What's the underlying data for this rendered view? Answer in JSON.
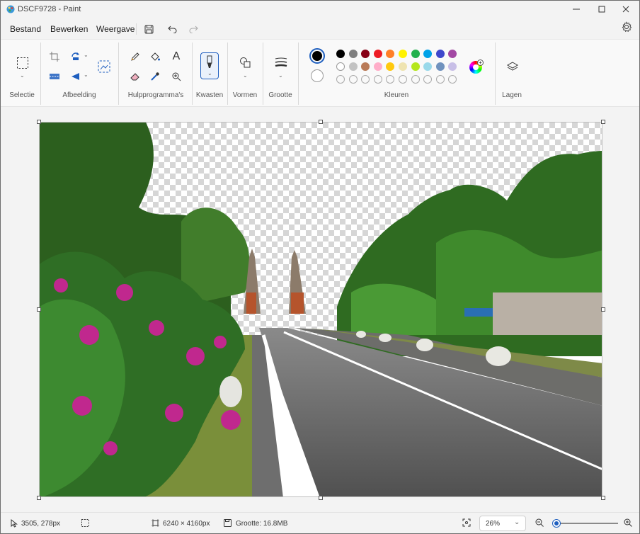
{
  "window": {
    "title": "DSCF9728 - Paint"
  },
  "menu": {
    "items": [
      "Bestand",
      "Bewerken",
      "Weergave"
    ]
  },
  "ribbon": {
    "groups": {
      "selection": "Selectie",
      "image": "Afbeelding",
      "tools": "Hulpprogramma's",
      "brushes": "Kwasten",
      "shapes": "Vormen",
      "size": "Grootte",
      "colors": "Kleuren",
      "layers": "Lagen"
    },
    "primary_color": "#000000",
    "secondary_color": "#ffffff",
    "palette_row1": [
      "#000000",
      "#7f7f7f",
      "#880015",
      "#ed1c24",
      "#ff7f27",
      "#fff200",
      "#22b14c",
      "#00a2e8",
      "#3f48cc",
      "#a349a4"
    ],
    "palette_row2": [
      "#ffffff",
      "#c3c3c3",
      "#b97a57",
      "#ffaec9",
      "#ffc90e",
      "#efe4b0",
      "#b5e61d",
      "#99d9ea",
      "#7092be",
      "#c8bfe7"
    ]
  },
  "status": {
    "cursor_position": "3505, 278px",
    "image_dimensions": "6240 × 4160px",
    "file_size": "Grootte: 16.8MB",
    "zoom_level": "26%"
  },
  "zoom": {
    "slider_fraction": 0.03
  }
}
